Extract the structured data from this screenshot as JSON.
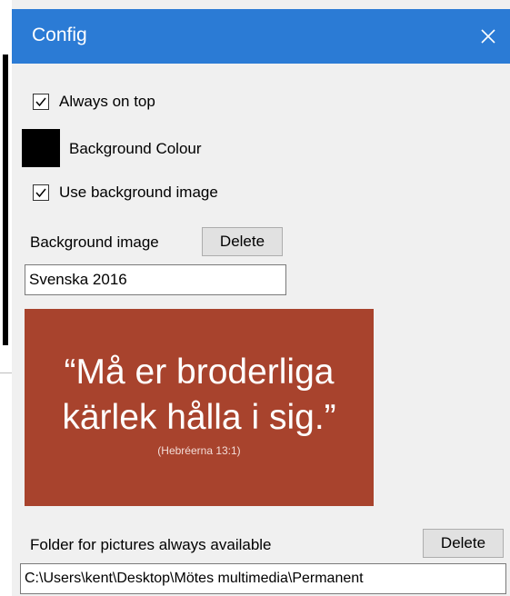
{
  "window": {
    "title": "Config",
    "close_label": "✕",
    "accent": "#2b7bd5"
  },
  "options": {
    "always_on_top": {
      "label": "Always on top",
      "checked": true
    },
    "background_colour": {
      "label": "Background Colour",
      "swatch": "#000000"
    },
    "use_background_image": {
      "label": "Use background image",
      "checked": true
    }
  },
  "background_image": {
    "label": "Background image",
    "delete_label": "Delete",
    "value": "Svenska 2016",
    "preview": {
      "background": "#a8432d",
      "line1": "“Må er broderliga",
      "line2": "kärlek hålla i sig.”",
      "reference": "(Hebréerna 13:1)"
    }
  },
  "folder": {
    "label": "Folder for pictures always available",
    "delete_label": "Delete",
    "path": "C:\\Users\\kent\\Desktop\\Mötes multimedia\\Permanent"
  }
}
